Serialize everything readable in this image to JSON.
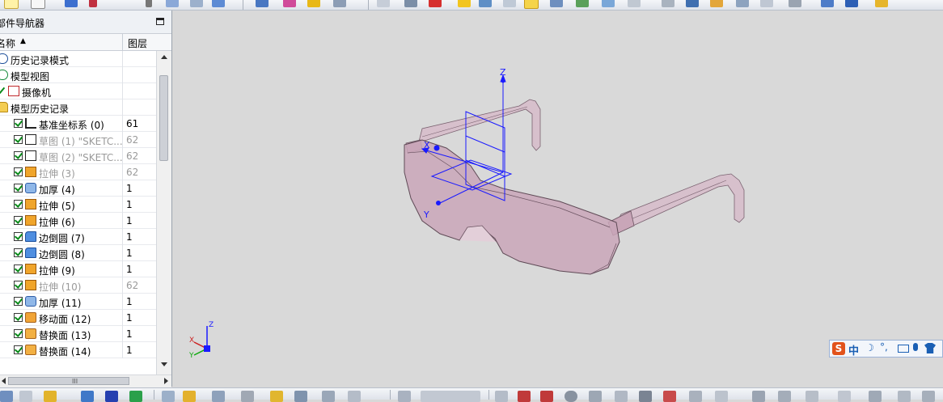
{
  "navigator": {
    "title": "部件导航器",
    "columns": {
      "name": "名称",
      "layer": "图层"
    },
    "rows": [
      {
        "label": "历史记录模式",
        "layer": "",
        "level": 0,
        "icon": "clock-icon",
        "checked": false,
        "dim": false
      },
      {
        "label": "模型视图",
        "layer": "",
        "level": 0,
        "icon": "model-view-icon",
        "checked": false,
        "dim": false
      },
      {
        "label": "摄像机",
        "layer": "",
        "level": 0,
        "icon": "camera-icon",
        "checked": true,
        "dim": false
      },
      {
        "label": "模型历史记录",
        "layer": "",
        "level": 0,
        "icon": "folder-icon",
        "checked": false,
        "dim": false
      },
      {
        "label": "基准坐标系 (0)",
        "layer": "61",
        "level": 1,
        "icon": "datum-csys-icon",
        "checked": true,
        "dim": false
      },
      {
        "label": "草图 (1) \"SKETC...",
        "layer": "62",
        "level": 1,
        "icon": "sketch-icon",
        "checked": true,
        "dim": true
      },
      {
        "label": "草图 (2) \"SKETC...",
        "layer": "62",
        "level": 1,
        "icon": "sketch-icon",
        "checked": true,
        "dim": true
      },
      {
        "label": "拉伸 (3)",
        "layer": "62",
        "level": 1,
        "icon": "extrude-icon",
        "checked": true,
        "dim": true
      },
      {
        "label": "加厚 (4)",
        "layer": "1",
        "level": 1,
        "icon": "thicken-icon",
        "checked": true,
        "dim": false
      },
      {
        "label": "拉伸 (5)",
        "layer": "1",
        "level": 1,
        "icon": "extrude-icon",
        "checked": true,
        "dim": false
      },
      {
        "label": "拉伸 (6)",
        "layer": "1",
        "level": 1,
        "icon": "extrude-icon",
        "checked": true,
        "dim": false
      },
      {
        "label": "边倒圆 (7)",
        "layer": "1",
        "level": 1,
        "icon": "edge-blend-icon",
        "checked": true,
        "dim": false
      },
      {
        "label": "边倒圆 (8)",
        "layer": "1",
        "level": 1,
        "icon": "edge-blend-icon",
        "checked": true,
        "dim": false
      },
      {
        "label": "拉伸 (9)",
        "layer": "1",
        "level": 1,
        "icon": "extrude-icon",
        "checked": true,
        "dim": false
      },
      {
        "label": "拉伸 (10)",
        "layer": "62",
        "level": 1,
        "icon": "extrude-icon",
        "checked": true,
        "dim": true
      },
      {
        "label": "加厚 (11)",
        "layer": "1",
        "level": 1,
        "icon": "thicken-icon",
        "checked": true,
        "dim": false
      },
      {
        "label": "移动面 (12)",
        "layer": "1",
        "level": 1,
        "icon": "move-face-icon",
        "checked": true,
        "dim": false
      },
      {
        "label": "替换面 (13)",
        "layer": "1",
        "level": 1,
        "icon": "replace-face-icon",
        "checked": true,
        "dim": false
      },
      {
        "label": "替换面 (14)",
        "layer": "1",
        "level": 1,
        "icon": "replace-face-icon",
        "checked": true,
        "dim": false
      }
    ],
    "hscroll_grip": "III"
  },
  "viewport": {
    "axes": {
      "z": "Z",
      "x": "X",
      "y": "Y"
    },
    "triad": {
      "z": "Z",
      "x": "X",
      "y": "Y"
    },
    "model_color": "#c9a6b8"
  },
  "ime": {
    "logo": "S",
    "lang": "中",
    "moon": "☽",
    "punct": "°,"
  },
  "colors": {
    "axis_blue": "#1a1aff",
    "checkmark": "#0a8a1a",
    "dim_text": "#9a9a9a"
  }
}
